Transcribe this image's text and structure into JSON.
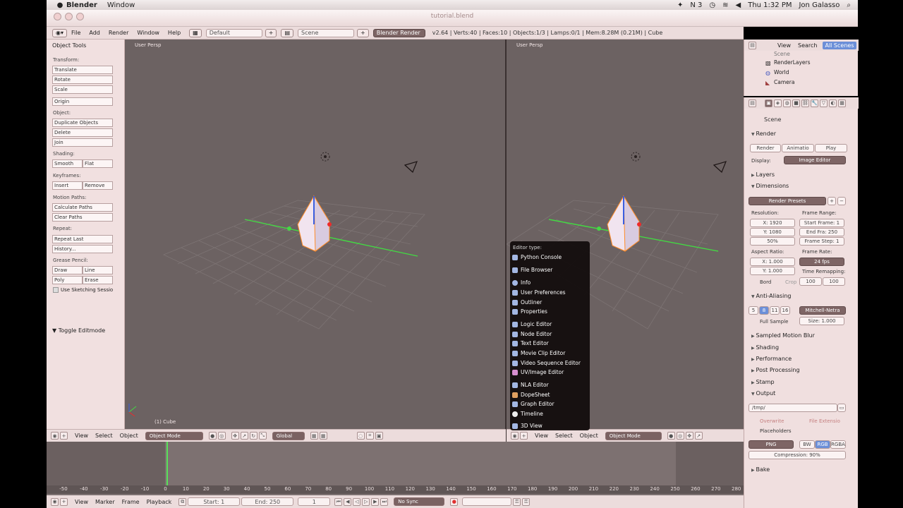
{
  "menubar": {
    "app": "Blender",
    "items": [
      "Window"
    ],
    "status_right": [
      "N 3",
      "Thu 1:32 PM",
      "Jon Galasso"
    ]
  },
  "window": {
    "document": "tutorial.blend"
  },
  "infobar": {
    "menus": [
      "File",
      "Add",
      "Render",
      "Window",
      "Help"
    ],
    "layout": "Default",
    "scene": "Scene",
    "engine": "Blender Render",
    "stats": "v2.64 | Verts:40 | Faces:10 | Objects:1/3 | Lamps:0/1 | Mem:8.28M (0.21M) | Cube"
  },
  "tools": {
    "title": "Object Tools",
    "transform_label": "Transform:",
    "translate": "Translate",
    "rotate": "Rotate",
    "scale": "Scale",
    "origin": "Origin",
    "object_label": "Object:",
    "duplicate": "Duplicate Objects",
    "delete": "Delete",
    "join": "Join",
    "shading_label": "Shading:",
    "smooth": "Smooth",
    "flat": "Flat",
    "keyframes_label": "Keyframes:",
    "insert": "Insert",
    "remove": "Remove",
    "motion_label": "Motion Paths:",
    "calc_paths": "Calculate Paths",
    "clear_paths": "Clear Paths",
    "repeat_label": "Repeat:",
    "repeat_last": "Repeat Last",
    "history": "History...",
    "grease_label": "Grease Pencil:",
    "draw": "Draw",
    "line": "Line",
    "poly": "Poly",
    "erase": "Erase",
    "sketching": "Use Sketching Sessio",
    "toggle_edit": "Toggle Editmode"
  },
  "viewport_left": {
    "label": "User Persp",
    "object": "(1) Cube"
  },
  "viewport_right": {
    "label": "User Persp"
  },
  "header3d": {
    "menus": [
      "View",
      "Select",
      "Object"
    ],
    "mode": "Object Mode",
    "orientation": "Global"
  },
  "popup": {
    "title": "Editor type:",
    "items": [
      "Python Console",
      "File Browser",
      "Info",
      "User Preferences",
      "Outliner",
      "Properties",
      "Logic Editor",
      "Node Editor",
      "Text Editor",
      "Movie Clip Editor",
      "Video Sequence Editor",
      "UV/Image Editor",
      "NLA Editor",
      "DopeSheet",
      "Graph Editor",
      "Timeline",
      "3D View"
    ]
  },
  "outliner": {
    "tabs": [
      "View",
      "Search",
      "All Scenes"
    ],
    "rows": [
      "Scene",
      "RenderLayers",
      "World",
      "Camera"
    ]
  },
  "props": {
    "scene": "Scene",
    "render_section": "Render",
    "render_btn": "Render",
    "anim_btn": "Animatio",
    "play_btn": "Play",
    "display_label": "Display:",
    "display_value": "Image Editor",
    "layers": "Layers",
    "dimensions": "Dimensions",
    "presets": "Render Presets",
    "resolution_label": "Resolution:",
    "res_x": "X: 1920",
    "res_y": "Y: 1080",
    "res_pct": "50%",
    "frame_range_label": "Frame Range:",
    "start_frame": "Start Frame: 1",
    "end_frame": "End Fra: 250",
    "frame_step": "Frame Step: 1",
    "aspect_label": "Aspect Ratio:",
    "aspect_x": "X: 1.000",
    "aspect_y": "Y: 1.000",
    "framerate_label": "Frame Rate:",
    "fps": "24 fps",
    "remap_label": "Time Remapping:",
    "remap_a": "100",
    "remap_b": "100",
    "bord": "Bord",
    "crop": "Crop",
    "aa": "Anti-Aliasing",
    "aa_5": "5",
    "aa_8": "8",
    "aa_11": "11",
    "aa_16": "16",
    "filter": "Mitchell-Netra",
    "full_sample": "Full Sample",
    "size": "Size: 1.000",
    "motion_blur": "Sampled Motion Blur",
    "shading": "Shading",
    "performance": "Performance",
    "post": "Post Processing",
    "stamp": "Stamp",
    "output": "Output",
    "output_path": "/tmp/",
    "overwrite": "Overwrite",
    "file_ext": "File Extensio",
    "placeholders": "Placeholders",
    "format": "PNG",
    "bw": "BW",
    "rgb": "RGB",
    "rgba": "RGBA",
    "compression": "Compression: 90%",
    "bake": "Bake"
  },
  "timeline": {
    "ticks": [
      "-50",
      "-40",
      "-30",
      "-20",
      "-10",
      "0",
      "10",
      "20",
      "30",
      "40",
      "50",
      "60",
      "70",
      "80",
      "90",
      "100",
      "110",
      "120",
      "130",
      "140",
      "150",
      "160",
      "170",
      "180",
      "190",
      "200",
      "210",
      "220",
      "230",
      "240",
      "250",
      "260",
      "270",
      "280"
    ],
    "menus": [
      "View",
      "Marker",
      "Frame",
      "Playback"
    ],
    "start": "Start: 1",
    "end": "End: 250",
    "current": "1",
    "sync": "No Sync"
  },
  "colors": {
    "viewport": "#6c6262",
    "accent": "#6c8fd8",
    "playhead": "#58e05a"
  }
}
